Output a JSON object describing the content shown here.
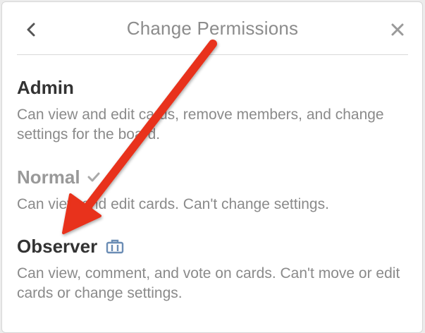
{
  "popover": {
    "title": "Change Permissions",
    "back_icon": "chevron-left-icon",
    "close_icon": "close-icon"
  },
  "options": [
    {
      "name": "Admin",
      "description": "Can view and edit cards, remove members, and change settings for the board.",
      "current": false
    },
    {
      "name": "Normal",
      "description": "Can view and edit cards. Can't change settings.",
      "current": true,
      "icon": "check-icon"
    },
    {
      "name": "Observer",
      "description": "Can view, comment, and vote on cards. Can't move or edit cards or change settings.",
      "current": false,
      "icon": "business-class-icon"
    }
  ],
  "annotation": {
    "color": "#e8321a",
    "icon": "red-arrow"
  }
}
